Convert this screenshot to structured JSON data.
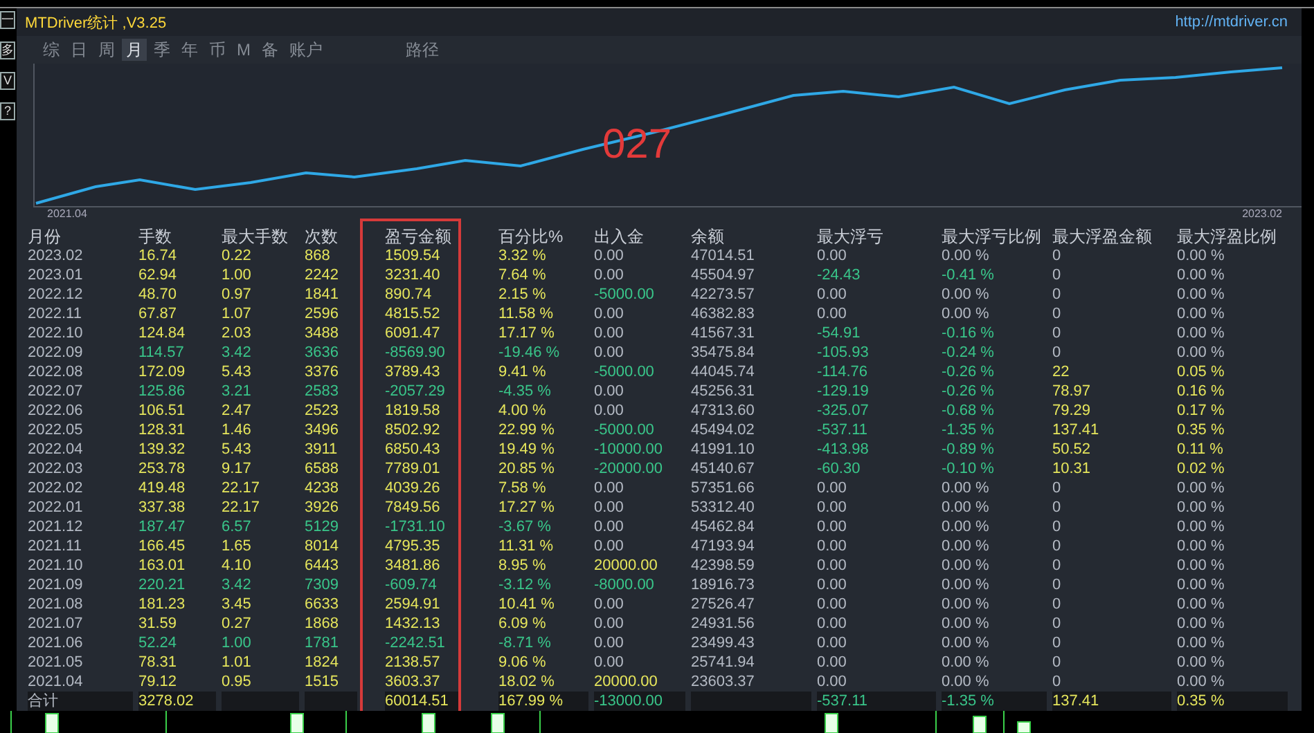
{
  "side_buttons": [
    "一",
    "多",
    "V",
    "?"
  ],
  "window": {
    "title": "MTDriver统计 ,V3.25",
    "link": "http://mtdriver.cn"
  },
  "tabs": [
    {
      "label": "综",
      "selected": false
    },
    {
      "label": "日",
      "selected": false
    },
    {
      "label": "周",
      "selected": false
    },
    {
      "label": "月",
      "selected": true
    },
    {
      "label": "季",
      "selected": false
    },
    {
      "label": "年",
      "selected": false
    },
    {
      "label": "币",
      "selected": false
    },
    {
      "label": "M",
      "selected": false
    },
    {
      "label": "备",
      "selected": false
    },
    {
      "label": "账户",
      "selected": false
    },
    {
      "label": "路径",
      "selected": false
    }
  ],
  "equity_chart": {
    "overlay_text": "027",
    "start_label": "2021.04",
    "end_label": "2023.02"
  },
  "table": {
    "columns": [
      {
        "label": "月份",
        "highlighted": false
      },
      {
        "label": "手数",
        "highlighted": false
      },
      {
        "label": "最大手数",
        "highlighted": false
      },
      {
        "label": "次数",
        "highlighted": false
      },
      {
        "label": "盈亏金额",
        "highlighted": true
      },
      {
        "label": "百分比%",
        "highlighted": false
      },
      {
        "label": "出入金",
        "highlighted": false
      },
      {
        "label": "余额",
        "highlighted": false
      },
      {
        "label": "最大浮亏",
        "highlighted": false
      },
      {
        "label": "最大浮亏比例",
        "highlighted": false
      },
      {
        "label": "最大浮盈金额",
        "highlighted": false
      },
      {
        "label": "最大浮盈比例",
        "highlighted": false
      }
    ],
    "rows": [
      {
        "cells": [
          {
            "text": "2023.02",
            "color": "#b4bac4"
          },
          {
            "text": "16.74",
            "color": "#e6e65c"
          },
          {
            "text": "0.22",
            "color": "#e6e65c"
          },
          {
            "text": "868",
            "color": "#e6e65c"
          },
          {
            "text": "1509.54",
            "color": "#e6e65c"
          },
          {
            "text": "3.32 %",
            "color": "#e6e65c"
          },
          {
            "text": "0.00",
            "color": "#b4bac4"
          },
          {
            "text": "47014.51",
            "color": "#b4bac4"
          },
          {
            "text": "0.00",
            "color": "#b4bac4"
          },
          {
            "text": "0.00 %",
            "color": "#b4bac4"
          },
          {
            "text": "0",
            "color": "#b4bac4"
          },
          {
            "text": "0.00 %",
            "color": "#b4bac4"
          }
        ]
      },
      {
        "cells": [
          {
            "text": "2023.01",
            "color": "#b4bac4"
          },
          {
            "text": "62.94",
            "color": "#e6e65c"
          },
          {
            "text": "1.00",
            "color": "#e6e65c"
          },
          {
            "text": "2242",
            "color": "#e6e65c"
          },
          {
            "text": "3231.40",
            "color": "#e6e65c"
          },
          {
            "text": "7.64 %",
            "color": "#e6e65c"
          },
          {
            "text": "0.00",
            "color": "#b4bac4"
          },
          {
            "text": "45504.97",
            "color": "#b4bac4"
          },
          {
            "text": "-24.43",
            "color": "#39c68a"
          },
          {
            "text": "-0.41 %",
            "color": "#39c68a"
          },
          {
            "text": "0",
            "color": "#b4bac4"
          },
          {
            "text": "0.00 %",
            "color": "#b4bac4"
          }
        ]
      },
      {
        "cells": [
          {
            "text": "2022.12",
            "color": "#b4bac4"
          },
          {
            "text": "48.70",
            "color": "#e6e65c"
          },
          {
            "text": "0.97",
            "color": "#e6e65c"
          },
          {
            "text": "1841",
            "color": "#e6e65c"
          },
          {
            "text": "890.74",
            "color": "#e6e65c"
          },
          {
            "text": "2.15 %",
            "color": "#e6e65c"
          },
          {
            "text": "-5000.00",
            "color": "#39c68a"
          },
          {
            "text": "42273.57",
            "color": "#b4bac4"
          },
          {
            "text": "0.00",
            "color": "#b4bac4"
          },
          {
            "text": "0.00 %",
            "color": "#b4bac4"
          },
          {
            "text": "0",
            "color": "#b4bac4"
          },
          {
            "text": "0.00 %",
            "color": "#b4bac4"
          }
        ]
      },
      {
        "cells": [
          {
            "text": "2022.11",
            "color": "#b4bac4"
          },
          {
            "text": "67.87",
            "color": "#e6e65c"
          },
          {
            "text": "1.07",
            "color": "#e6e65c"
          },
          {
            "text": "2596",
            "color": "#e6e65c"
          },
          {
            "text": "4815.52",
            "color": "#e6e65c"
          },
          {
            "text": "11.58 %",
            "color": "#e6e65c"
          },
          {
            "text": "0.00",
            "color": "#b4bac4"
          },
          {
            "text": "46382.83",
            "color": "#b4bac4"
          },
          {
            "text": "0.00",
            "color": "#b4bac4"
          },
          {
            "text": "0.00 %",
            "color": "#b4bac4"
          },
          {
            "text": "0",
            "color": "#b4bac4"
          },
          {
            "text": "0.00 %",
            "color": "#b4bac4"
          }
        ]
      },
      {
        "cells": [
          {
            "text": "2022.10",
            "color": "#b4bac4"
          },
          {
            "text": "124.84",
            "color": "#e6e65c"
          },
          {
            "text": "2.03",
            "color": "#e6e65c"
          },
          {
            "text": "3488",
            "color": "#e6e65c"
          },
          {
            "text": "6091.47",
            "color": "#e6e65c"
          },
          {
            "text": "17.17 %",
            "color": "#e6e65c"
          },
          {
            "text": "0.00",
            "color": "#b4bac4"
          },
          {
            "text": "41567.31",
            "color": "#b4bac4"
          },
          {
            "text": "-54.91",
            "color": "#39c68a"
          },
          {
            "text": "-0.16 %",
            "color": "#39c68a"
          },
          {
            "text": "0",
            "color": "#b4bac4"
          },
          {
            "text": "0.00 %",
            "color": "#b4bac4"
          }
        ]
      },
      {
        "cells": [
          {
            "text": "2022.09",
            "color": "#b4bac4"
          },
          {
            "text": "114.57",
            "color": "#39c68a"
          },
          {
            "text": "3.42",
            "color": "#39c68a"
          },
          {
            "text": "3636",
            "color": "#39c68a"
          },
          {
            "text": "-8569.90",
            "color": "#39c68a"
          },
          {
            "text": "-19.46 %",
            "color": "#39c68a"
          },
          {
            "text": "0.00",
            "color": "#b4bac4"
          },
          {
            "text": "35475.84",
            "color": "#b4bac4"
          },
          {
            "text": "-105.93",
            "color": "#39c68a"
          },
          {
            "text": "-0.24 %",
            "color": "#39c68a"
          },
          {
            "text": "0",
            "color": "#b4bac4"
          },
          {
            "text": "0.00 %",
            "color": "#b4bac4"
          }
        ]
      },
      {
        "cells": [
          {
            "text": "2022.08",
            "color": "#b4bac4"
          },
          {
            "text": "172.09",
            "color": "#e6e65c"
          },
          {
            "text": "5.43",
            "color": "#e6e65c"
          },
          {
            "text": "3376",
            "color": "#e6e65c"
          },
          {
            "text": "3789.43",
            "color": "#e6e65c"
          },
          {
            "text": "9.41 %",
            "color": "#e6e65c"
          },
          {
            "text": "-5000.00",
            "color": "#39c68a"
          },
          {
            "text": "44045.74",
            "color": "#b4bac4"
          },
          {
            "text": "-114.76",
            "color": "#39c68a"
          },
          {
            "text": "-0.26 %",
            "color": "#39c68a"
          },
          {
            "text": "22",
            "color": "#e6e65c"
          },
          {
            "text": "0.05 %",
            "color": "#e6e65c"
          }
        ]
      },
      {
        "cells": [
          {
            "text": "2022.07",
            "color": "#b4bac4"
          },
          {
            "text": "125.86",
            "color": "#39c68a"
          },
          {
            "text": "3.21",
            "color": "#39c68a"
          },
          {
            "text": "2583",
            "color": "#39c68a"
          },
          {
            "text": "-2057.29",
            "color": "#39c68a"
          },
          {
            "text": "-4.35 %",
            "color": "#39c68a"
          },
          {
            "text": "0.00",
            "color": "#b4bac4"
          },
          {
            "text": "45256.31",
            "color": "#b4bac4"
          },
          {
            "text": "-129.19",
            "color": "#39c68a"
          },
          {
            "text": "-0.26 %",
            "color": "#39c68a"
          },
          {
            "text": "78.97",
            "color": "#e6e65c"
          },
          {
            "text": "0.16 %",
            "color": "#e6e65c"
          }
        ]
      },
      {
        "cells": [
          {
            "text": "2022.06",
            "color": "#b4bac4"
          },
          {
            "text": "106.51",
            "color": "#e6e65c"
          },
          {
            "text": "2.47",
            "color": "#e6e65c"
          },
          {
            "text": "2523",
            "color": "#e6e65c"
          },
          {
            "text": "1819.58",
            "color": "#e6e65c"
          },
          {
            "text": "4.00 %",
            "color": "#e6e65c"
          },
          {
            "text": "0.00",
            "color": "#b4bac4"
          },
          {
            "text": "47313.60",
            "color": "#b4bac4"
          },
          {
            "text": "-325.07",
            "color": "#39c68a"
          },
          {
            "text": "-0.68 %",
            "color": "#39c68a"
          },
          {
            "text": "79.29",
            "color": "#e6e65c"
          },
          {
            "text": "0.17 %",
            "color": "#e6e65c"
          }
        ]
      },
      {
        "cells": [
          {
            "text": "2022.05",
            "color": "#b4bac4"
          },
          {
            "text": "128.31",
            "color": "#e6e65c"
          },
          {
            "text": "1.46",
            "color": "#e6e65c"
          },
          {
            "text": "3496",
            "color": "#e6e65c"
          },
          {
            "text": "8502.92",
            "color": "#e6e65c"
          },
          {
            "text": "22.99 %",
            "color": "#e6e65c"
          },
          {
            "text": "-5000.00",
            "color": "#39c68a"
          },
          {
            "text": "45494.02",
            "color": "#b4bac4"
          },
          {
            "text": "-537.11",
            "color": "#39c68a"
          },
          {
            "text": "-1.35 %",
            "color": "#39c68a"
          },
          {
            "text": "137.41",
            "color": "#e6e65c"
          },
          {
            "text": "0.35 %",
            "color": "#e6e65c"
          }
        ]
      },
      {
        "cells": [
          {
            "text": "2022.04",
            "color": "#b4bac4"
          },
          {
            "text": "139.32",
            "color": "#e6e65c"
          },
          {
            "text": "5.43",
            "color": "#e6e65c"
          },
          {
            "text": "3911",
            "color": "#e6e65c"
          },
          {
            "text": "6850.43",
            "color": "#e6e65c"
          },
          {
            "text": "19.49 %",
            "color": "#e6e65c"
          },
          {
            "text": "-10000.00",
            "color": "#39c68a"
          },
          {
            "text": "41991.10",
            "color": "#b4bac4"
          },
          {
            "text": "-413.98",
            "color": "#39c68a"
          },
          {
            "text": "-0.89 %",
            "color": "#39c68a"
          },
          {
            "text": "50.52",
            "color": "#e6e65c"
          },
          {
            "text": "0.11 %",
            "color": "#e6e65c"
          }
        ]
      },
      {
        "cells": [
          {
            "text": "2022.03",
            "color": "#b4bac4"
          },
          {
            "text": "253.78",
            "color": "#e6e65c"
          },
          {
            "text": "9.17",
            "color": "#e6e65c"
          },
          {
            "text": "6588",
            "color": "#e6e65c"
          },
          {
            "text": "7789.01",
            "color": "#e6e65c"
          },
          {
            "text": "20.85 %",
            "color": "#e6e65c"
          },
          {
            "text": "-20000.00",
            "color": "#39c68a"
          },
          {
            "text": "45140.67",
            "color": "#b4bac4"
          },
          {
            "text": "-60.30",
            "color": "#39c68a"
          },
          {
            "text": "-0.10 %",
            "color": "#39c68a"
          },
          {
            "text": "10.31",
            "color": "#e6e65c"
          },
          {
            "text": "0.02 %",
            "color": "#e6e65c"
          }
        ]
      },
      {
        "cells": [
          {
            "text": "2022.02",
            "color": "#b4bac4"
          },
          {
            "text": "419.48",
            "color": "#e6e65c"
          },
          {
            "text": "22.17",
            "color": "#e6e65c"
          },
          {
            "text": "4238",
            "color": "#e6e65c"
          },
          {
            "text": "4039.26",
            "color": "#e6e65c"
          },
          {
            "text": "7.58 %",
            "color": "#e6e65c"
          },
          {
            "text": "0.00",
            "color": "#b4bac4"
          },
          {
            "text": "57351.66",
            "color": "#b4bac4"
          },
          {
            "text": "0.00",
            "color": "#b4bac4"
          },
          {
            "text": "0.00 %",
            "color": "#b4bac4"
          },
          {
            "text": "0",
            "color": "#b4bac4"
          },
          {
            "text": "0.00 %",
            "color": "#b4bac4"
          }
        ]
      },
      {
        "cells": [
          {
            "text": "2022.01",
            "color": "#b4bac4"
          },
          {
            "text": "337.38",
            "color": "#e6e65c"
          },
          {
            "text": "22.17",
            "color": "#e6e65c"
          },
          {
            "text": "3926",
            "color": "#e6e65c"
          },
          {
            "text": "7849.56",
            "color": "#e6e65c"
          },
          {
            "text": "17.27 %",
            "color": "#e6e65c"
          },
          {
            "text": "0.00",
            "color": "#b4bac4"
          },
          {
            "text": "53312.40",
            "color": "#b4bac4"
          },
          {
            "text": "0.00",
            "color": "#b4bac4"
          },
          {
            "text": "0.00 %",
            "color": "#b4bac4"
          },
          {
            "text": "0",
            "color": "#b4bac4"
          },
          {
            "text": "0.00 %",
            "color": "#b4bac4"
          }
        ]
      },
      {
        "cells": [
          {
            "text": "2021.12",
            "color": "#b4bac4"
          },
          {
            "text": "187.47",
            "color": "#39c68a"
          },
          {
            "text": "6.57",
            "color": "#39c68a"
          },
          {
            "text": "5129",
            "color": "#39c68a"
          },
          {
            "text": "-1731.10",
            "color": "#39c68a"
          },
          {
            "text": "-3.67 %",
            "color": "#39c68a"
          },
          {
            "text": "0.00",
            "color": "#b4bac4"
          },
          {
            "text": "45462.84",
            "color": "#b4bac4"
          },
          {
            "text": "0.00",
            "color": "#b4bac4"
          },
          {
            "text": "0.00 %",
            "color": "#b4bac4"
          },
          {
            "text": "0",
            "color": "#b4bac4"
          },
          {
            "text": "0.00 %",
            "color": "#b4bac4"
          }
        ]
      },
      {
        "cells": [
          {
            "text": "2021.11",
            "color": "#b4bac4"
          },
          {
            "text": "166.45",
            "color": "#e6e65c"
          },
          {
            "text": "1.65",
            "color": "#e6e65c"
          },
          {
            "text": "8014",
            "color": "#e6e65c"
          },
          {
            "text": "4795.35",
            "color": "#e6e65c"
          },
          {
            "text": "11.31 %",
            "color": "#e6e65c"
          },
          {
            "text": "0.00",
            "color": "#b4bac4"
          },
          {
            "text": "47193.94",
            "color": "#b4bac4"
          },
          {
            "text": "0.00",
            "color": "#b4bac4"
          },
          {
            "text": "0.00 %",
            "color": "#b4bac4"
          },
          {
            "text": "0",
            "color": "#b4bac4"
          },
          {
            "text": "0.00 %",
            "color": "#b4bac4"
          }
        ]
      },
      {
        "cells": [
          {
            "text": "2021.10",
            "color": "#b4bac4"
          },
          {
            "text": "163.01",
            "color": "#e6e65c"
          },
          {
            "text": "4.10",
            "color": "#e6e65c"
          },
          {
            "text": "6443",
            "color": "#e6e65c"
          },
          {
            "text": "3481.86",
            "color": "#e6e65c"
          },
          {
            "text": "8.95 %",
            "color": "#e6e65c"
          },
          {
            "text": "20000.00",
            "color": "#e6e65c"
          },
          {
            "text": "42398.59",
            "color": "#b4bac4"
          },
          {
            "text": "0.00",
            "color": "#b4bac4"
          },
          {
            "text": "0.00 %",
            "color": "#b4bac4"
          },
          {
            "text": "0",
            "color": "#b4bac4"
          },
          {
            "text": "0.00 %",
            "color": "#b4bac4"
          }
        ]
      },
      {
        "cells": [
          {
            "text": "2021.09",
            "color": "#b4bac4"
          },
          {
            "text": "220.21",
            "color": "#39c68a"
          },
          {
            "text": "3.42",
            "color": "#39c68a"
          },
          {
            "text": "7309",
            "color": "#39c68a"
          },
          {
            "text": "-609.74",
            "color": "#39c68a"
          },
          {
            "text": "-3.12 %",
            "color": "#39c68a"
          },
          {
            "text": "-8000.00",
            "color": "#39c68a"
          },
          {
            "text": "18916.73",
            "color": "#b4bac4"
          },
          {
            "text": "0.00",
            "color": "#b4bac4"
          },
          {
            "text": "0.00 %",
            "color": "#b4bac4"
          },
          {
            "text": "0",
            "color": "#b4bac4"
          },
          {
            "text": "0.00 %",
            "color": "#b4bac4"
          }
        ]
      },
      {
        "cells": [
          {
            "text": "2021.08",
            "color": "#b4bac4"
          },
          {
            "text": "181.23",
            "color": "#e6e65c"
          },
          {
            "text": "3.45",
            "color": "#e6e65c"
          },
          {
            "text": "6633",
            "color": "#e6e65c"
          },
          {
            "text": "2594.91",
            "color": "#e6e65c"
          },
          {
            "text": "10.41 %",
            "color": "#e6e65c"
          },
          {
            "text": "0.00",
            "color": "#b4bac4"
          },
          {
            "text": "27526.47",
            "color": "#b4bac4"
          },
          {
            "text": "0.00",
            "color": "#b4bac4"
          },
          {
            "text": "0.00 %",
            "color": "#b4bac4"
          },
          {
            "text": "0",
            "color": "#b4bac4"
          },
          {
            "text": "0.00 %",
            "color": "#b4bac4"
          }
        ]
      },
      {
        "cells": [
          {
            "text": "2021.07",
            "color": "#b4bac4"
          },
          {
            "text": "31.59",
            "color": "#e6e65c"
          },
          {
            "text": "0.27",
            "color": "#e6e65c"
          },
          {
            "text": "1868",
            "color": "#e6e65c"
          },
          {
            "text": "1432.13",
            "color": "#e6e65c"
          },
          {
            "text": "6.09 %",
            "color": "#e6e65c"
          },
          {
            "text": "0.00",
            "color": "#b4bac4"
          },
          {
            "text": "24931.56",
            "color": "#b4bac4"
          },
          {
            "text": "0.00",
            "color": "#b4bac4"
          },
          {
            "text": "0.00 %",
            "color": "#b4bac4"
          },
          {
            "text": "0",
            "color": "#b4bac4"
          },
          {
            "text": "0.00 %",
            "color": "#b4bac4"
          }
        ]
      },
      {
        "cells": [
          {
            "text": "2021.06",
            "color": "#b4bac4"
          },
          {
            "text": "52.24",
            "color": "#39c68a"
          },
          {
            "text": "1.00",
            "color": "#39c68a"
          },
          {
            "text": "1781",
            "color": "#39c68a"
          },
          {
            "text": "-2242.51",
            "color": "#39c68a"
          },
          {
            "text": "-8.71 %",
            "color": "#39c68a"
          },
          {
            "text": "0.00",
            "color": "#b4bac4"
          },
          {
            "text": "23499.43",
            "color": "#b4bac4"
          },
          {
            "text": "0.00",
            "color": "#b4bac4"
          },
          {
            "text": "0.00 %",
            "color": "#b4bac4"
          },
          {
            "text": "0",
            "color": "#b4bac4"
          },
          {
            "text": "0.00 %",
            "color": "#b4bac4"
          }
        ]
      },
      {
        "cells": [
          {
            "text": "2021.05",
            "color": "#b4bac4"
          },
          {
            "text": "78.31",
            "color": "#e6e65c"
          },
          {
            "text": "1.01",
            "color": "#e6e65c"
          },
          {
            "text": "1824",
            "color": "#e6e65c"
          },
          {
            "text": "2138.57",
            "color": "#e6e65c"
          },
          {
            "text": "9.06 %",
            "color": "#e6e65c"
          },
          {
            "text": "0.00",
            "color": "#b4bac4"
          },
          {
            "text": "25741.94",
            "color": "#b4bac4"
          },
          {
            "text": "0.00",
            "color": "#b4bac4"
          },
          {
            "text": "0.00 %",
            "color": "#b4bac4"
          },
          {
            "text": "0",
            "color": "#b4bac4"
          },
          {
            "text": "0.00 %",
            "color": "#b4bac4"
          }
        ]
      },
      {
        "cells": [
          {
            "text": "2021.04",
            "color": "#b4bac4"
          },
          {
            "text": "79.12",
            "color": "#e6e65c"
          },
          {
            "text": "0.95",
            "color": "#e6e65c"
          },
          {
            "text": "1515",
            "color": "#e6e65c"
          },
          {
            "text": "3603.37",
            "color": "#e6e65c"
          },
          {
            "text": "18.02 %",
            "color": "#e6e65c"
          },
          {
            "text": "20000.00",
            "color": "#e6e65c"
          },
          {
            "text": "23603.37",
            "color": "#b4bac4"
          },
          {
            "text": "0.00",
            "color": "#b4bac4"
          },
          {
            "text": "0.00 %",
            "color": "#b4bac4"
          },
          {
            "text": "0",
            "color": "#b4bac4"
          },
          {
            "text": "0.00 %",
            "color": "#b4bac4"
          }
        ]
      }
    ],
    "total": {
      "cells": [
        {
          "text": "合计",
          "color": "#b4bac4"
        },
        {
          "text": "3278.02",
          "color": "#e6e65c"
        },
        null,
        null,
        {
          "text": "60014.51",
          "color": "#e6e65c"
        },
        {
          "text": "167.99 %",
          "color": "#e6e65c"
        },
        {
          "text": "-13000.00",
          "color": "#39c68a"
        },
        null,
        {
          "text": "-537.11",
          "color": "#39c68a"
        },
        {
          "text": "-1.35 %",
          "color": "#39c68a"
        },
        {
          "text": "137.41",
          "color": "#e6e65c"
        },
        {
          "text": "0.35 %",
          "color": "#e6e65c"
        }
      ]
    }
  }
}
